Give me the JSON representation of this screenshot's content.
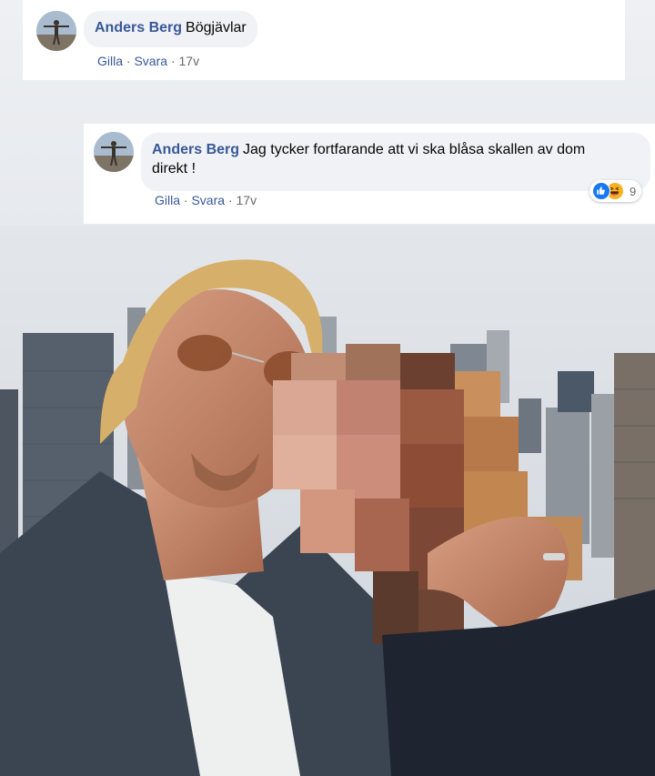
{
  "comments": [
    {
      "author": "Anders Berg",
      "text": "Bögjävlar",
      "like_label": "Gilla",
      "separator": "·",
      "reply_label": "Svara",
      "time": "17v"
    },
    {
      "author": "Anders Berg",
      "text_line1": "Jag tycker fortfarande att vi ska blåsa skallen av dom",
      "text_line2": "direkt !",
      "like_label": "Gilla",
      "separator": "·",
      "reply_label": "Svara",
      "time": "17v",
      "reactions": {
        "icons": [
          "like-icon",
          "haha-icon"
        ],
        "count": "9"
      }
    }
  ],
  "colors": {
    "author": "#385898",
    "link": "#385898",
    "muted": "#65676b",
    "bubble": "#f0f2f5",
    "like_blue": "#1877f2",
    "haha_yellow": "#f7b125"
  },
  "photo": {
    "description_icon": "selfie-photo",
    "blurred_region": "pixelated-face"
  }
}
